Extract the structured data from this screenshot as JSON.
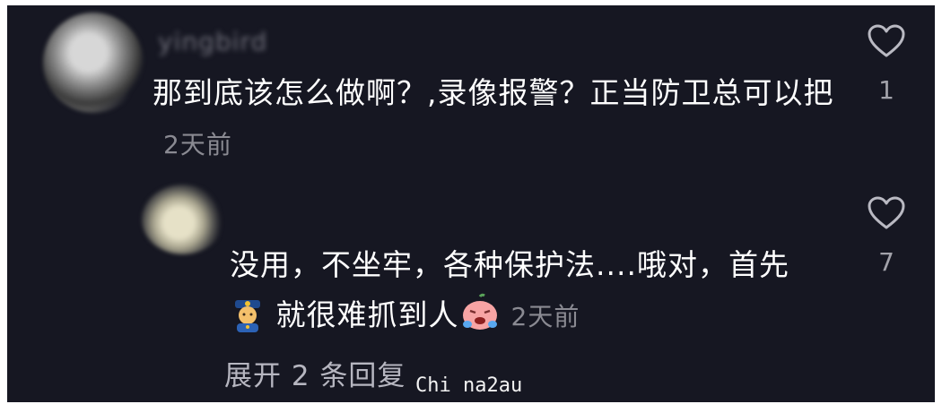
{
  "comments": [
    {
      "username": "yingbird",
      "text": "那到底该怎么做啊？,录像报警？正当防卫总可以把",
      "time": "2天前",
      "likes": "1"
    },
    {
      "username": "",
      "text_before_emoji": "没用，不坐牢，各种保护法....哦对，首先",
      "text_after_emoji": "就很难抓到人",
      "time": "2天前",
      "likes": "7",
      "emoji_icons": [
        "police-officer-icon",
        "crying-face-icon"
      ]
    }
  ],
  "expand_replies": "展开 2 条回复",
  "watermark": "Chi na2au",
  "colors": {
    "background": "#161722",
    "text": "#ffffff",
    "muted": "#8a8a92"
  }
}
